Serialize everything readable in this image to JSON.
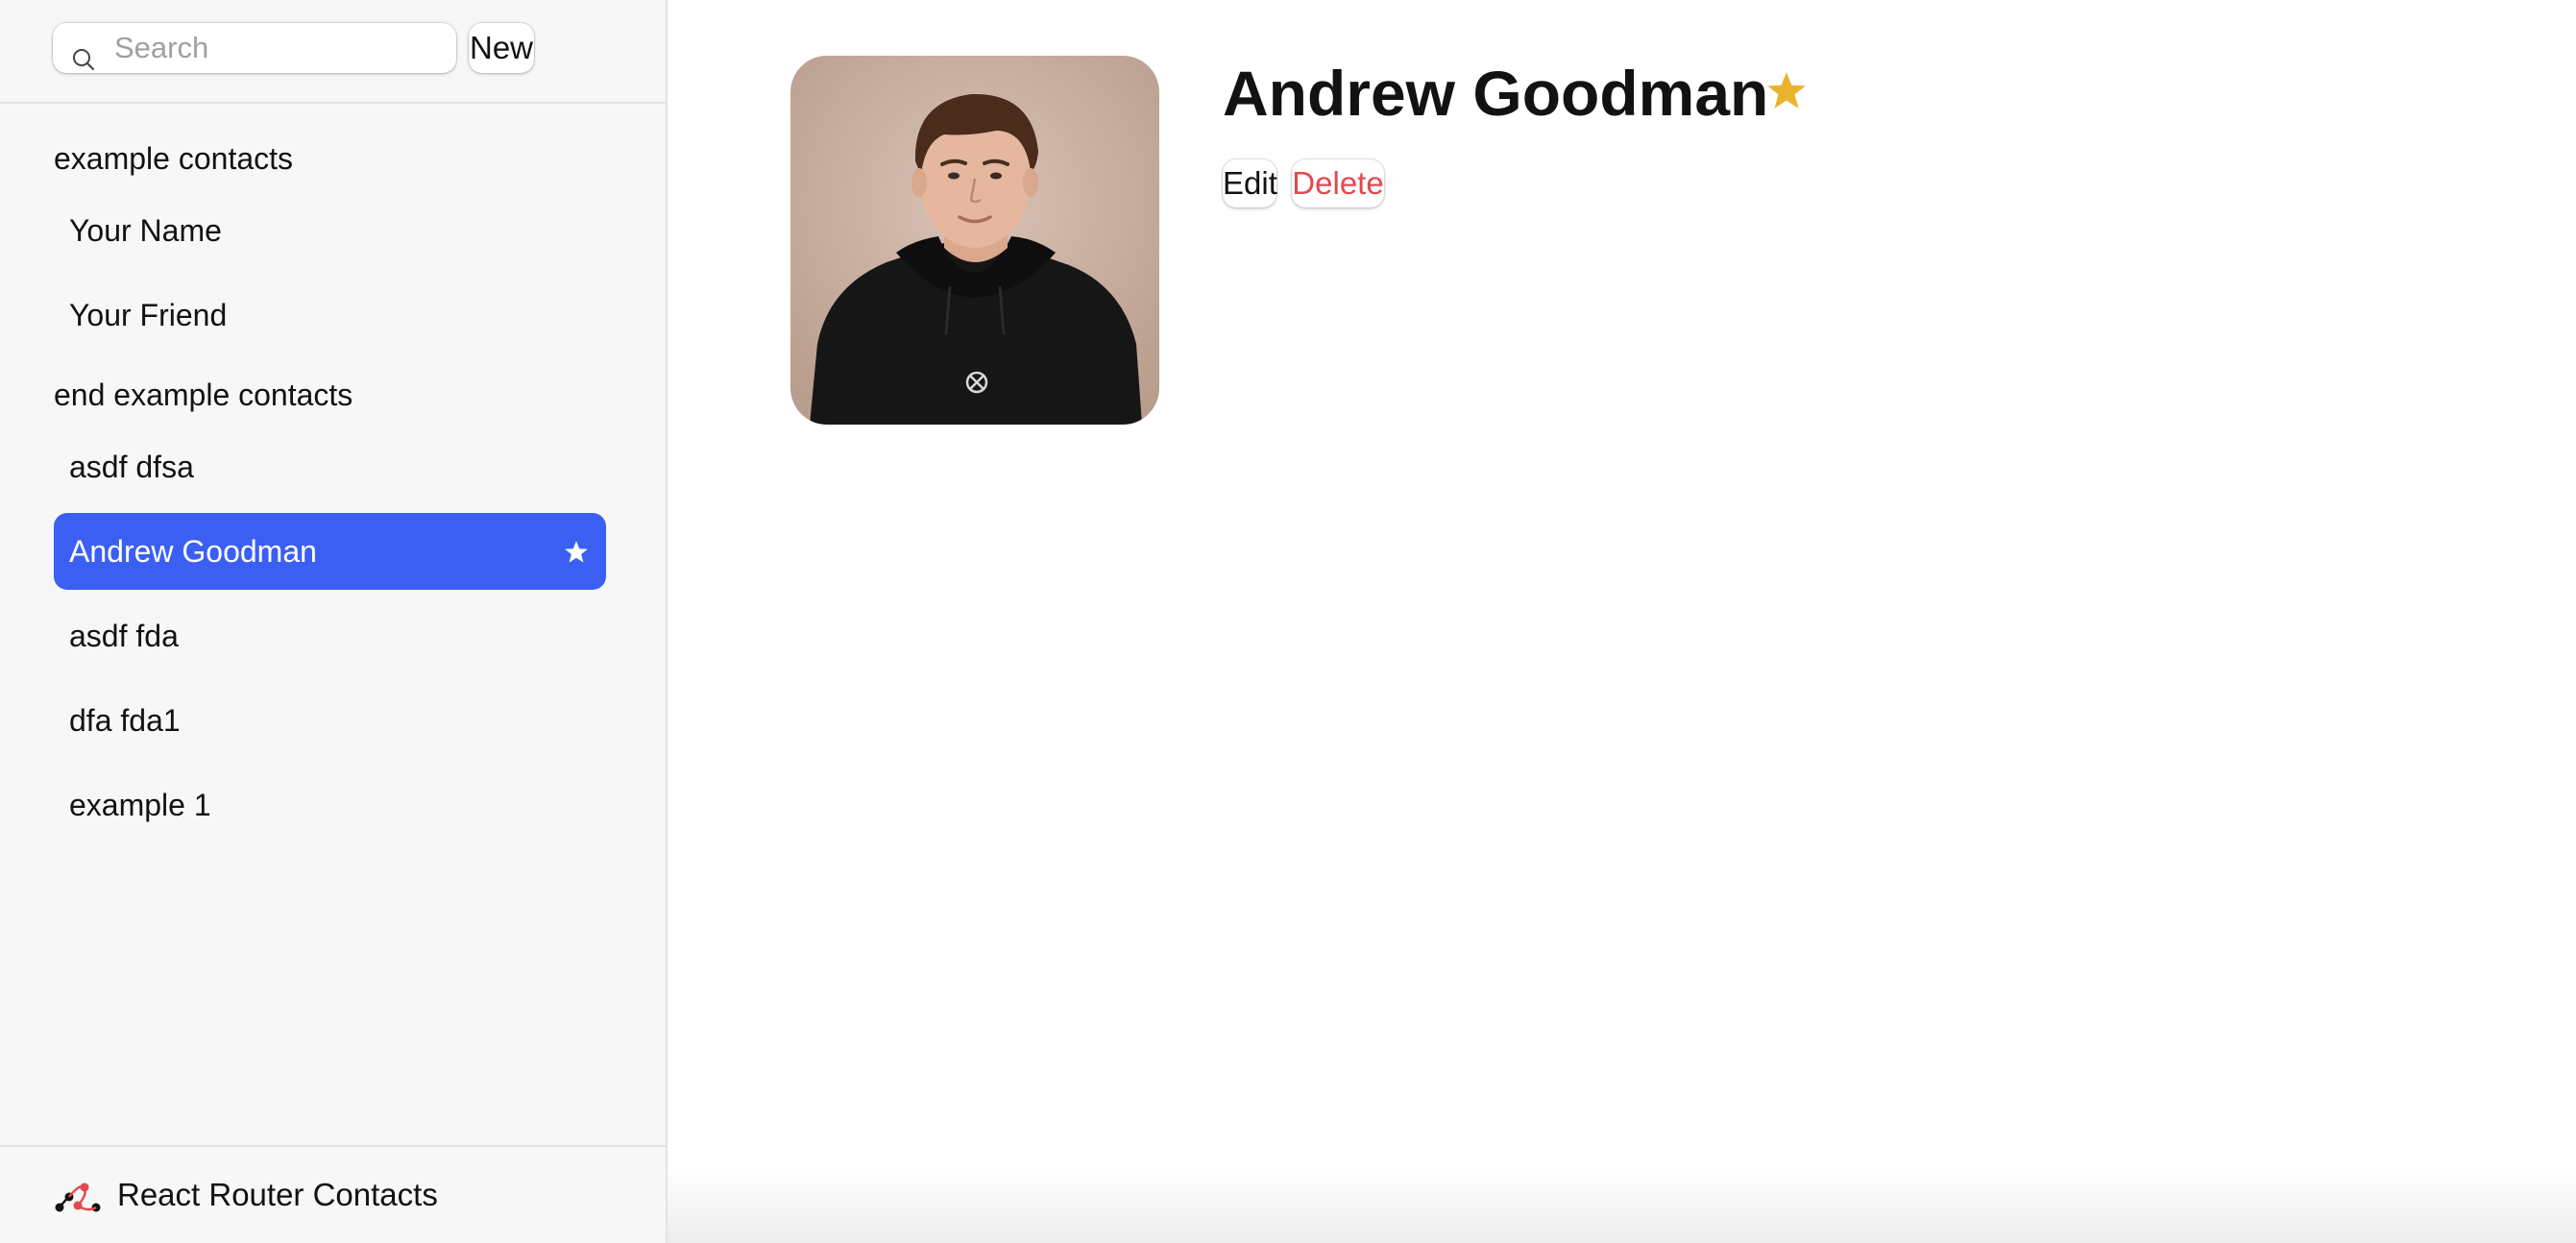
{
  "search": {
    "placeholder": "Search",
    "value": ""
  },
  "toolbar": {
    "new_label": "New"
  },
  "sidebar": {
    "entries": [
      {
        "kind": "heading",
        "label": "example contacts"
      },
      {
        "kind": "contact",
        "label": "Your Name",
        "active": false,
        "favorite": false
      },
      {
        "kind": "contact",
        "label": "Your Friend",
        "active": false,
        "favorite": false
      },
      {
        "kind": "heading",
        "label": "end example contacts"
      },
      {
        "kind": "contact",
        "label": "asdf dfsa",
        "active": false,
        "favorite": false
      },
      {
        "kind": "contact",
        "label": "Andrew Goodman",
        "active": true,
        "favorite": true
      },
      {
        "kind": "contact",
        "label": "asdf fda",
        "active": false,
        "favorite": false
      },
      {
        "kind": "contact",
        "label": "dfa fda1",
        "active": false,
        "favorite": false
      },
      {
        "kind": "contact",
        "label": "example 1",
        "active": false,
        "favorite": false
      }
    ]
  },
  "footer": {
    "brand_name": "React Router Contacts",
    "brand_icon": "react-router-logo"
  },
  "detail": {
    "name": "Andrew Goodman",
    "favorite": true,
    "avatar_icon": "person-photo",
    "edit_label": "Edit",
    "delete_label": "Delete"
  },
  "colors": {
    "sidebar_bg": "#f7f7f7",
    "active_item": "#3b5ff3",
    "favorite_star": "#e9b32d",
    "delete_text": "#e5484d",
    "logo_accent": "#e5484d"
  }
}
